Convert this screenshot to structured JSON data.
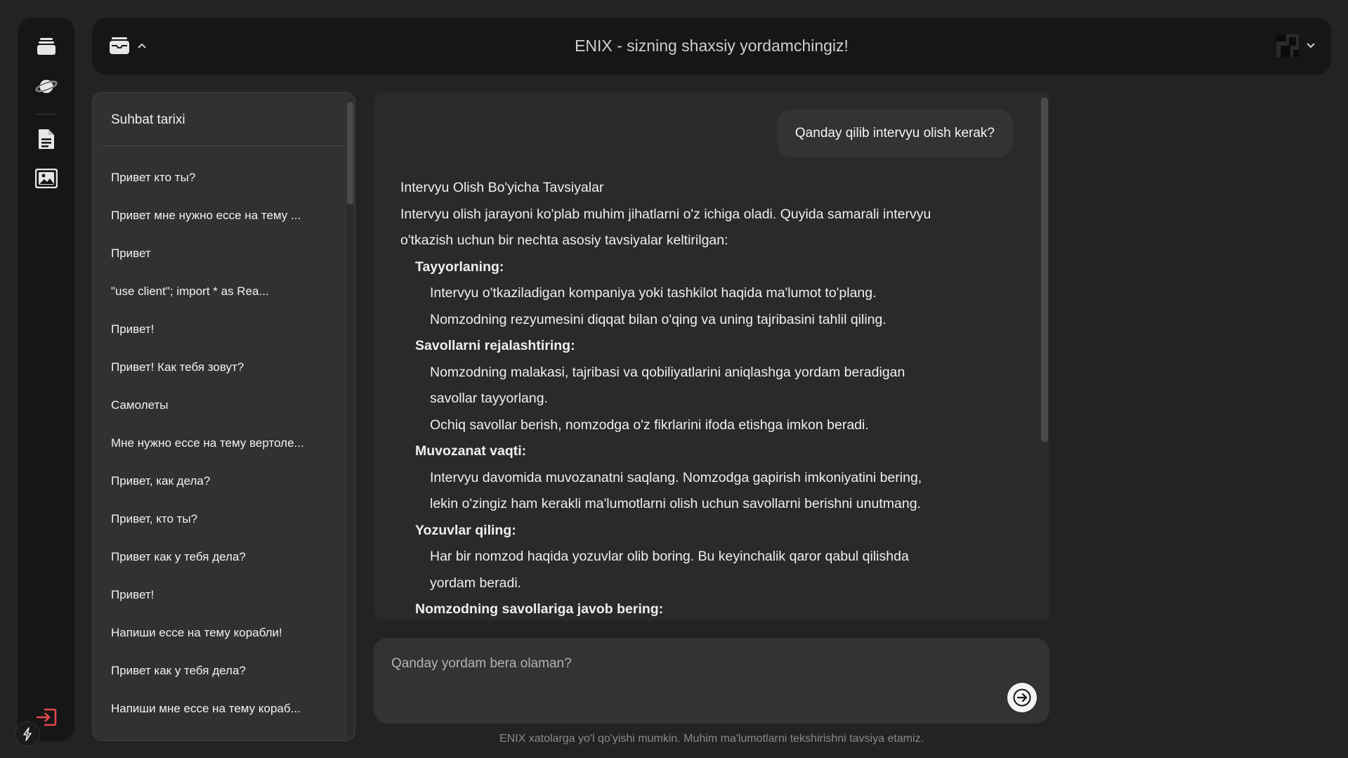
{
  "app": {
    "title": "ENIX - sizning shaxsiy yordamchingiz!"
  },
  "rail": {
    "icons": [
      "cards-stack-icon",
      "planet-icon",
      "document-icon",
      "image-gallery-icon",
      "logout-icon",
      "lightning-icon"
    ],
    "logout_color": "#e5484d"
  },
  "history": {
    "title": "Suhbat tarixi",
    "items": [
      "Привет кто ты?",
      "Привет мне нужно ессе на тему ...",
      "Привет",
      "\"use client\"; import * as Rea...",
      "Привет!",
      "Привет! Как тебя зовут?",
      "Самолеты",
      "Мне нужно ессе на тему вертоле...",
      "Привет, как дела?",
      "Привет, кто ты?",
      "Привет как у тебя дела?",
      "Привет!",
      "Напиши ессе на тему корабли!",
      "Привет как у тебя дела?",
      "Напиши мне ессе на тему кораб...",
      "Привет!"
    ]
  },
  "chat": {
    "user_message": "Qanday qilib intervyu olish kerak?",
    "answer_lines": [
      {
        "kind": "p",
        "text": "Intervyu Olish Bo'yicha Tavsiyalar"
      },
      {
        "kind": "p",
        "text": "Intervyu olish jarayoni ko'plab muhim jihatlarni o'z ichiga oladi. Quyida samarali intervyu"
      },
      {
        "kind": "p",
        "text": "o'tkazish uchun bir nechta asosiy tavsiyalar keltirilgan:"
      },
      {
        "kind": "h",
        "text": "Tayyorlaning:"
      },
      {
        "kind": "b",
        "text": "Intervyu o'tkaziladigan kompaniya yoki tashkilot haqida ma'lumot to'plang."
      },
      {
        "kind": "b",
        "text": "Nomzodning rezyumesini diqqat bilan o'qing va uning tajribasini tahlil qiling."
      },
      {
        "kind": "h",
        "text": "Savollarni rejalashtiring:"
      },
      {
        "kind": "b",
        "text": "Nomzodning malakasi, tajribasi va qobiliyatlarini aniqlashga yordam beradigan"
      },
      {
        "kind": "b",
        "text": "savollar tayyorlang."
      },
      {
        "kind": "b",
        "text": "Ochiq savollar berish, nomzodga o'z fikrlarini ifoda etishga imkon beradi."
      },
      {
        "kind": "h",
        "text": "Muvozanat vaqti:"
      },
      {
        "kind": "b",
        "text": "Intervyu davomida muvozanatni saqlang. Nomzodga gapirish imkoniyatini bering,"
      },
      {
        "kind": "b",
        "text": "lekin o'zingiz ham kerakli ma'lumotlarni olish uchun savollarni berishni unutmang."
      },
      {
        "kind": "h",
        "text": "Yozuvlar qiling:"
      },
      {
        "kind": "b",
        "text": "Har bir nomzod haqida yozuvlar olib boring. Bu keyinchalik qaror qabul qilishda"
      },
      {
        "kind": "b",
        "text": "yordam beradi."
      },
      {
        "kind": "h",
        "text": "Nomzodning savollariga javob bering:"
      }
    ]
  },
  "composer": {
    "placeholder": "Qanday yordam bera olaman?",
    "value": ""
  },
  "footer": {
    "disclaimer": "ENIX xatolarga yo'l qo'yishi mumkin. Muhim ma'lumotlarni tekshirishni tavsiya etamiz."
  }
}
